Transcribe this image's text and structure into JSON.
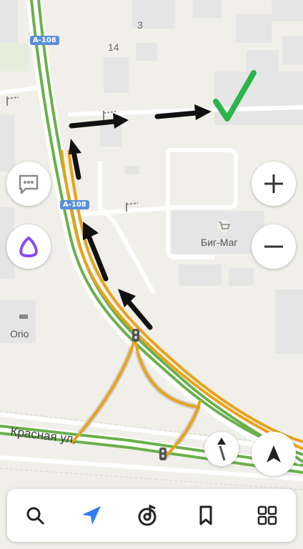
{
  "map": {
    "highway_label": "А-108",
    "road_label": "Красная ул.",
    "store_label": "Биг-Маг",
    "poi_label": "Orio",
    "house_numbers": [
      "3",
      "14"
    ]
  },
  "annotations": {
    "checkmark_color": "#2cb34a",
    "arrow_color": "#111111"
  },
  "colors": {
    "route_green": "#6ab04c",
    "traffic_orange": "#e9a21b",
    "map_background": "#f1efe9",
    "building": "#e4e4e4",
    "alice_purple": "#8a4bf2",
    "nav_blue": "#2f7cf6"
  },
  "controls": {
    "zoom_in": "+",
    "zoom_out": "−"
  },
  "bottom_nav": {
    "items": [
      "search-icon",
      "navigation-arrow-icon",
      "music-icon",
      "bookmarks-icon",
      "services-grid-icon"
    ],
    "active": "navigation-arrow-icon"
  }
}
